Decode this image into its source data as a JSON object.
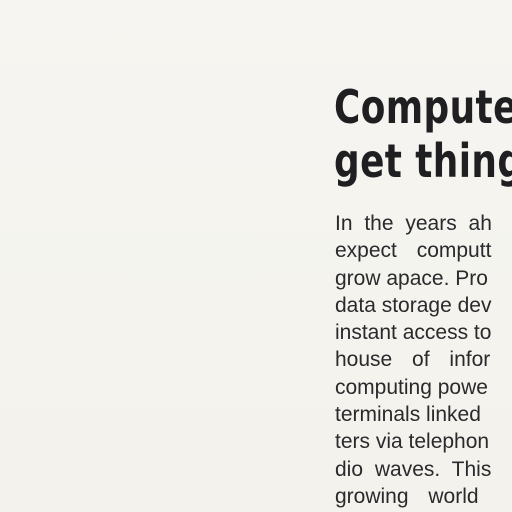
{
  "article": {
    "headline_lines": [
      "Compute",
      "get thing"
    ],
    "body_lines": [
      "In the years ah",
      "expect computt",
      "grow apace. Pro",
      "data storage dev",
      "instant access to",
      "house of infor",
      "computing powe",
      "terminals linked",
      "ters via telephon",
      "dio waves. This",
      "growing world"
    ]
  }
}
